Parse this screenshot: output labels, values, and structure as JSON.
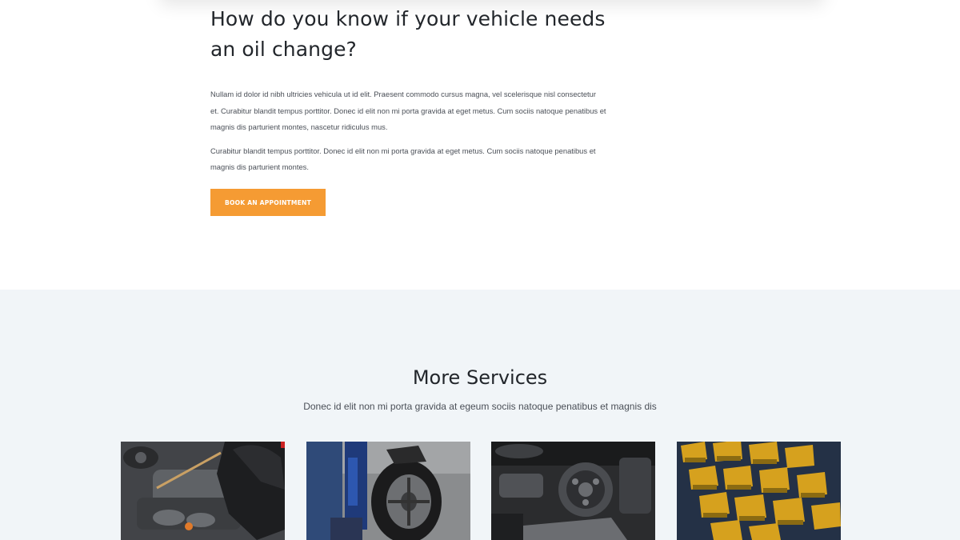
{
  "intro": {
    "heading": "How do you know if your vehicle needs an oil change?",
    "paragraph_1": "Nullam id dolor id nibh ultricies vehicula ut id elit. Praesent commodo cursus magna, vel scelerisque nisl consectetur et. Curabitur blandit tempus porttitor. Donec id elit non mi porta gravida at eget metus. Cum sociis natoque penatibus et magnis dis parturient montes, nascetur ridiculus mus.",
    "paragraph_2": "Curabitur blandit tempus porttitor. Donec id elit non mi porta gravida at eget metus. Cum sociis natoque penatibus et magnis dis parturient montes.",
    "cta_label": "BOOK AN APPOINTMENT"
  },
  "services": {
    "title": "More Services",
    "subtitle": "Donec id elit non mi porta gravida at egeum sociis natoque penatibus et magnis dis",
    "cards": [
      {
        "image": "engine-oil-dipstick-photo"
      },
      {
        "image": "tire-change-photo"
      },
      {
        "image": "engine-pulley-photo"
      },
      {
        "image": "parts-bins-photo"
      }
    ]
  },
  "colors": {
    "accent": "#f59b33",
    "section_bg": "#f1f5f8",
    "heading": "#22262b",
    "body_text": "#4a4f57"
  }
}
